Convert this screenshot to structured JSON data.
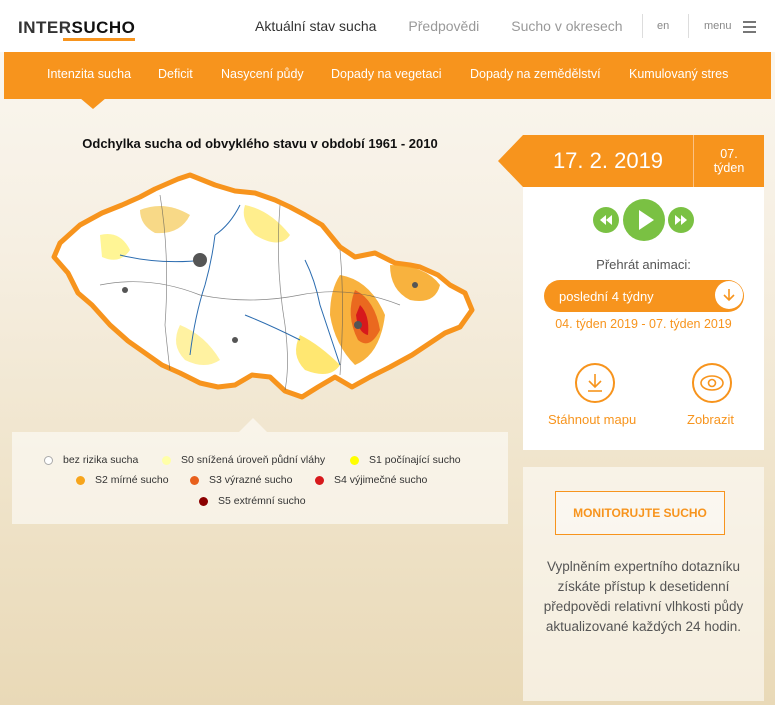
{
  "header": {
    "logo_prefix": "INTER",
    "logo_suffix": "SUCHO",
    "nav": [
      "Aktuální stav sucha",
      "Předpovědi",
      "Sucho v okresech"
    ],
    "lang": "en",
    "menu": "menu"
  },
  "subnav": [
    "Intenzita sucha",
    "Deficit",
    "Nasycení půdy",
    "Dopady na vegetaci",
    "Dopady na zemědělství",
    "Kumulovaný stres"
  ],
  "map": {
    "title": "Odchylka sucha od obvyklého stavu v období 1961 - 2010"
  },
  "legend": [
    {
      "label": "bez rizika sucha",
      "color": "#ffffff"
    },
    {
      "label": "S0 snížená úroveň půdní vláhy",
      "color": "#ffffa8"
    },
    {
      "label": "S1 počínající sucho",
      "color": "#ffff00"
    },
    {
      "label": "S2 mírné sucho",
      "color": "#f7a51c"
    },
    {
      "label": "S3 výrazné sucho",
      "color": "#e8601c"
    },
    {
      "label": "S4 výjimečné sucho",
      "color": "#d7191c"
    },
    {
      "label": "S5 extrémní sucho",
      "color": "#8b0000"
    }
  ],
  "panel": {
    "date": "17. 2. 2019",
    "week_num": "07.",
    "week_label": "týden",
    "play_label": "Přehrát animaci:",
    "period_select": "poslední 4 týdny",
    "range": "04. týden 2019 - 07. týden 2019",
    "download": "Stáhnout mapu",
    "view": "Zobrazit"
  },
  "monitor": {
    "button": "MONITORUJTE SUCHO",
    "text": "Vyplněním expertního dotazníku získáte přístup k desetidenní předpovědi relativní vlhkosti půdy aktualizované každých 24 hodin."
  },
  "colors": {
    "accent": "#f7941d",
    "play": "#7ac143"
  }
}
